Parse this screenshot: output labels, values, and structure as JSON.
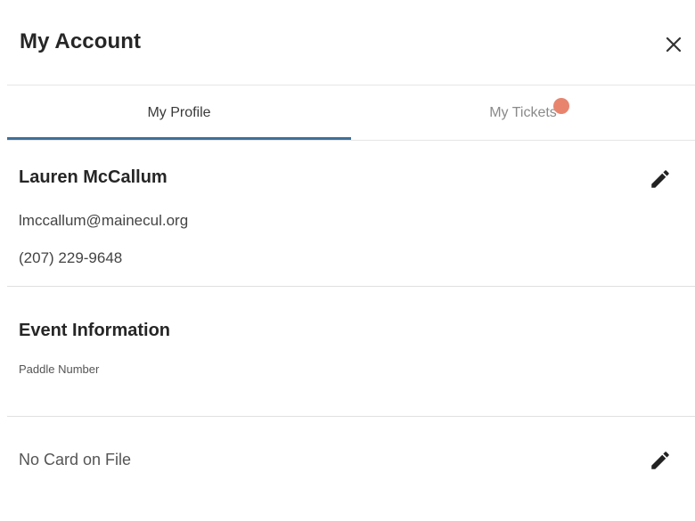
{
  "header": {
    "title": "My Account",
    "close_icon": "close-icon"
  },
  "tabs": [
    {
      "label": "My Profile",
      "active": true
    },
    {
      "label": "My Tickets",
      "active": false,
      "has_notification": true
    }
  ],
  "profile": {
    "name": "Lauren McCallum",
    "email": "lmccallum@mainecul.org",
    "phone": "(207) 229-9648",
    "edit_icon": "pencil-icon"
  },
  "event_info": {
    "title": "Event Information",
    "paddle_label": "Paddle Number"
  },
  "payment": {
    "status": "No Card on File",
    "edit_icon": "pencil-icon"
  },
  "colors": {
    "accent": "#3f6f9a",
    "notification": "#e8846e"
  }
}
